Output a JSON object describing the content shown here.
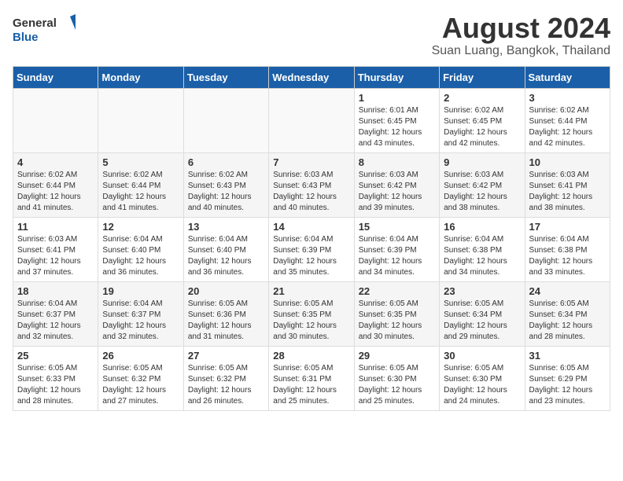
{
  "header": {
    "logo_line1": "General",
    "logo_line2": "Blue",
    "title": "August 2024",
    "subtitle": "Suan Luang, Bangkok, Thailand"
  },
  "weekdays": [
    "Sunday",
    "Monday",
    "Tuesday",
    "Wednesday",
    "Thursday",
    "Friday",
    "Saturday"
  ],
  "weeks": [
    [
      {
        "day": "",
        "detail": ""
      },
      {
        "day": "",
        "detail": ""
      },
      {
        "day": "",
        "detail": ""
      },
      {
        "day": "",
        "detail": ""
      },
      {
        "day": "1",
        "detail": "Sunrise: 6:01 AM\nSunset: 6:45 PM\nDaylight: 12 hours\nand 43 minutes."
      },
      {
        "day": "2",
        "detail": "Sunrise: 6:02 AM\nSunset: 6:45 PM\nDaylight: 12 hours\nand 42 minutes."
      },
      {
        "day": "3",
        "detail": "Sunrise: 6:02 AM\nSunset: 6:44 PM\nDaylight: 12 hours\nand 42 minutes."
      }
    ],
    [
      {
        "day": "4",
        "detail": "Sunrise: 6:02 AM\nSunset: 6:44 PM\nDaylight: 12 hours\nand 41 minutes."
      },
      {
        "day": "5",
        "detail": "Sunrise: 6:02 AM\nSunset: 6:44 PM\nDaylight: 12 hours\nand 41 minutes."
      },
      {
        "day": "6",
        "detail": "Sunrise: 6:02 AM\nSunset: 6:43 PM\nDaylight: 12 hours\nand 40 minutes."
      },
      {
        "day": "7",
        "detail": "Sunrise: 6:03 AM\nSunset: 6:43 PM\nDaylight: 12 hours\nand 40 minutes."
      },
      {
        "day": "8",
        "detail": "Sunrise: 6:03 AM\nSunset: 6:42 PM\nDaylight: 12 hours\nand 39 minutes."
      },
      {
        "day": "9",
        "detail": "Sunrise: 6:03 AM\nSunset: 6:42 PM\nDaylight: 12 hours\nand 38 minutes."
      },
      {
        "day": "10",
        "detail": "Sunrise: 6:03 AM\nSunset: 6:41 PM\nDaylight: 12 hours\nand 38 minutes."
      }
    ],
    [
      {
        "day": "11",
        "detail": "Sunrise: 6:03 AM\nSunset: 6:41 PM\nDaylight: 12 hours\nand 37 minutes."
      },
      {
        "day": "12",
        "detail": "Sunrise: 6:04 AM\nSunset: 6:40 PM\nDaylight: 12 hours\nand 36 minutes."
      },
      {
        "day": "13",
        "detail": "Sunrise: 6:04 AM\nSunset: 6:40 PM\nDaylight: 12 hours\nand 36 minutes."
      },
      {
        "day": "14",
        "detail": "Sunrise: 6:04 AM\nSunset: 6:39 PM\nDaylight: 12 hours\nand 35 minutes."
      },
      {
        "day": "15",
        "detail": "Sunrise: 6:04 AM\nSunset: 6:39 PM\nDaylight: 12 hours\nand 34 minutes."
      },
      {
        "day": "16",
        "detail": "Sunrise: 6:04 AM\nSunset: 6:38 PM\nDaylight: 12 hours\nand 34 minutes."
      },
      {
        "day": "17",
        "detail": "Sunrise: 6:04 AM\nSunset: 6:38 PM\nDaylight: 12 hours\nand 33 minutes."
      }
    ],
    [
      {
        "day": "18",
        "detail": "Sunrise: 6:04 AM\nSunset: 6:37 PM\nDaylight: 12 hours\nand 32 minutes."
      },
      {
        "day": "19",
        "detail": "Sunrise: 6:04 AM\nSunset: 6:37 PM\nDaylight: 12 hours\nand 32 minutes."
      },
      {
        "day": "20",
        "detail": "Sunrise: 6:05 AM\nSunset: 6:36 PM\nDaylight: 12 hours\nand 31 minutes."
      },
      {
        "day": "21",
        "detail": "Sunrise: 6:05 AM\nSunset: 6:35 PM\nDaylight: 12 hours\nand 30 minutes."
      },
      {
        "day": "22",
        "detail": "Sunrise: 6:05 AM\nSunset: 6:35 PM\nDaylight: 12 hours\nand 30 minutes."
      },
      {
        "day": "23",
        "detail": "Sunrise: 6:05 AM\nSunset: 6:34 PM\nDaylight: 12 hours\nand 29 minutes."
      },
      {
        "day": "24",
        "detail": "Sunrise: 6:05 AM\nSunset: 6:34 PM\nDaylight: 12 hours\nand 28 minutes."
      }
    ],
    [
      {
        "day": "25",
        "detail": "Sunrise: 6:05 AM\nSunset: 6:33 PM\nDaylight: 12 hours\nand 28 minutes."
      },
      {
        "day": "26",
        "detail": "Sunrise: 6:05 AM\nSunset: 6:32 PM\nDaylight: 12 hours\nand 27 minutes."
      },
      {
        "day": "27",
        "detail": "Sunrise: 6:05 AM\nSunset: 6:32 PM\nDaylight: 12 hours\nand 26 minutes."
      },
      {
        "day": "28",
        "detail": "Sunrise: 6:05 AM\nSunset: 6:31 PM\nDaylight: 12 hours\nand 25 minutes."
      },
      {
        "day": "29",
        "detail": "Sunrise: 6:05 AM\nSunset: 6:30 PM\nDaylight: 12 hours\nand 25 minutes."
      },
      {
        "day": "30",
        "detail": "Sunrise: 6:05 AM\nSunset: 6:30 PM\nDaylight: 12 hours\nand 24 minutes."
      },
      {
        "day": "31",
        "detail": "Sunrise: 6:05 AM\nSunset: 6:29 PM\nDaylight: 12 hours\nand 23 minutes."
      }
    ]
  ]
}
